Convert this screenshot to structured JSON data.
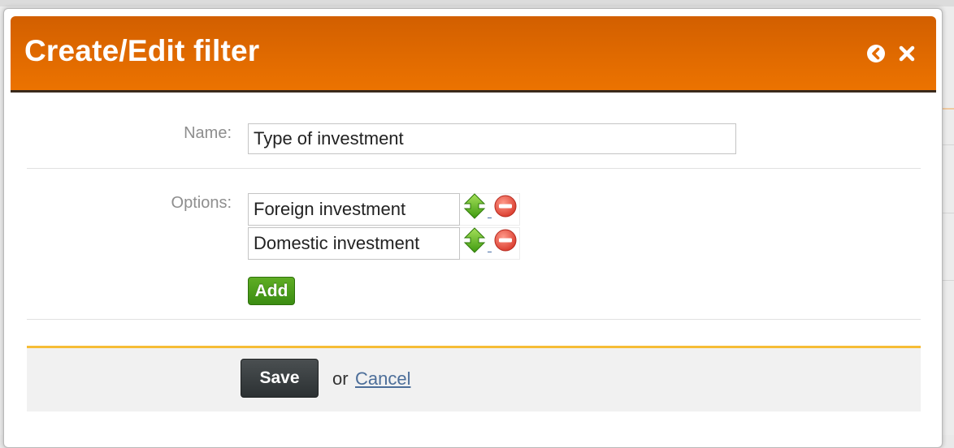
{
  "dialog": {
    "title": "Create/Edit filter",
    "icons": {
      "back": "circle-arrow-left-icon",
      "close": "close-icon"
    },
    "colors": {
      "header": "#e56e00",
      "add_button": "#4a9a18",
      "footer_accent": "#f6bd36"
    }
  },
  "form": {
    "name_label": "Name:",
    "name_value": "Type of investment",
    "options_label": "Options:",
    "options": [
      {
        "value": "Foreign investment"
      },
      {
        "value": "Domestic investment"
      }
    ],
    "option_icons": {
      "move": "up-down-arrow-icon",
      "remove": "remove-circle-icon"
    },
    "add_label": "Add"
  },
  "footer": {
    "save_label": "Save",
    "or_text": "or",
    "cancel_label": "Cancel"
  }
}
